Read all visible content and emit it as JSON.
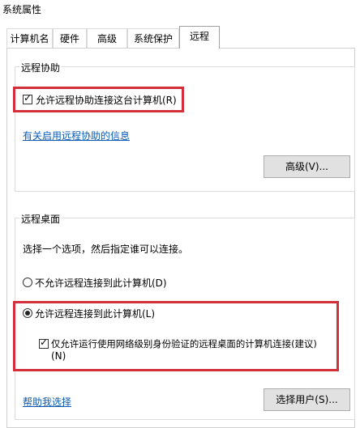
{
  "window": {
    "title": "系统属性"
  },
  "tabs": [
    {
      "label": "计算机名"
    },
    {
      "label": "硬件"
    },
    {
      "label": "高级"
    },
    {
      "label": "系统保护"
    },
    {
      "label": "远程"
    }
  ],
  "remote_assistance": {
    "group_label": "远程协助",
    "checkbox_label": "允许远程协助连接这台计算机(R)",
    "checkbox_checked": true,
    "info_link": "有关启用远程协助的信息",
    "advanced_button": "高级(V)..."
  },
  "remote_desktop": {
    "group_label": "远程桌面",
    "description": "选择一个选项，然后指定谁可以连接。",
    "option_disallow": "不允许远程连接到此计算机(D)",
    "option_allow": "允许远程连接到此计算机(L)",
    "selected_option": "allow",
    "nla_checkbox_label_line1": "仅允许运行使用网络级别身份验证的远程桌面的计算机连接(建议)",
    "nla_checkbox_label_line2": "(N)",
    "nla_checked": true,
    "help_link": "帮助我选择",
    "select_users_button": "选择用户(S)..."
  },
  "colors": {
    "highlight": "#d32f3a",
    "link": "#0b5bb5"
  }
}
